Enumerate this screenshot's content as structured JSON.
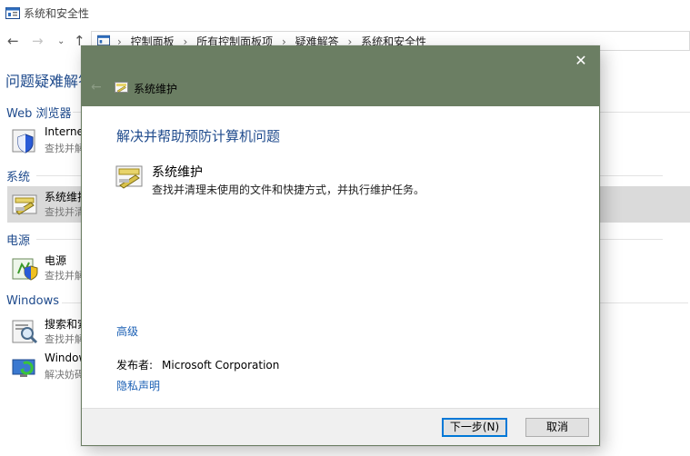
{
  "window": {
    "title": "系统和安全性"
  },
  "nav": {
    "back_icon": "arrow-left-icon",
    "forward_icon": "arrow-right-icon",
    "recent_icon": "chevron-down-icon",
    "up_icon": "arrow-up-icon",
    "breadcrumb": [
      "控制面板",
      "所有控制面板项",
      "疑难解答",
      "系统和安全性"
    ]
  },
  "background": {
    "page_title": "问题疑难解答",
    "sections": [
      {
        "header": "Web 浏览器",
        "items": [
          {
            "title": "Internet",
            "subtitle": "查找并解",
            "icon": "ie-shield-icon"
          }
        ]
      },
      {
        "header": "系统",
        "items": [
          {
            "title": "系统维护",
            "subtitle": "查找并清",
            "icon": "maintenance-icon",
            "selected": true
          }
        ]
      },
      {
        "header": "电源",
        "items": [
          {
            "title": "电源",
            "subtitle": "查找并解",
            "icon": "power-shield-icon"
          }
        ]
      },
      {
        "header": "Windows",
        "items": [
          {
            "title": "搜索和索",
            "subtitle": "查找并解",
            "icon": "search-index-icon"
          },
          {
            "title": "Window",
            "subtitle": "解决妨碍",
            "icon": "windows-update-icon"
          }
        ]
      }
    ]
  },
  "dialog": {
    "title": "系统维护",
    "close_label": "✕",
    "back_label": "←",
    "heading": "解决并帮助预防计算机问题",
    "task": {
      "title": "系统维护",
      "description": "查找并清理未使用的文件和快捷方式，并执行维护任务。",
      "icon": "maintenance-icon"
    },
    "advanced_link": "高级",
    "publisher_label": "发布者:",
    "publisher_value": "Microsoft Corporation",
    "privacy_link": "隐私声明",
    "buttons": {
      "next": "下一步(N)",
      "cancel": "取消"
    }
  },
  "colors": {
    "dialog_header": "#6b7e63",
    "link": "#1a5fb4",
    "heading": "#1e4a8c",
    "selected_row": "#dadada"
  }
}
